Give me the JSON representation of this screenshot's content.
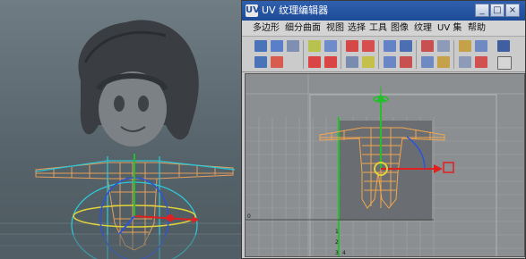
{
  "uv_editor": {
    "title": "UV 纹理编辑器",
    "icon_label": "UV",
    "window_buttons": {
      "minimize": "_",
      "maximize": "□",
      "close": "×"
    },
    "menu": [
      "多边形",
      "细分曲面",
      "视图",
      "选择",
      "工具",
      "图像",
      "纹理",
      "UV 集",
      "帮助"
    ],
    "grid_labels": {
      "row_label": "0",
      "bottom_numbers": [
        "1",
        "2",
        "3",
        "4"
      ]
    }
  },
  "colors": {
    "viewport_bg": "#5f6c73",
    "wireframe": "#f0a35a",
    "selection_cyan": "#2dc6d6",
    "manipulator_red": "#e02020",
    "manipulator_green": "#22c02a",
    "manipulator_yellow": "#e0d23a",
    "uv_mesh": "#f2a74f",
    "titlebar_blue": "#1d4b98"
  },
  "icons": [
    "translate-tool-icon",
    "rotate-tool-icon",
    "scale-tool-icon",
    "flip-uv-icon",
    "rotate-uv-icon",
    "cut-uv-icon",
    "sew-uv-icon",
    "grid-uv-icon",
    "snap-icon",
    "select-shell-icon",
    "move-sew-icon",
    "layout-icon",
    "image-display-icon",
    "checker-icon"
  ]
}
